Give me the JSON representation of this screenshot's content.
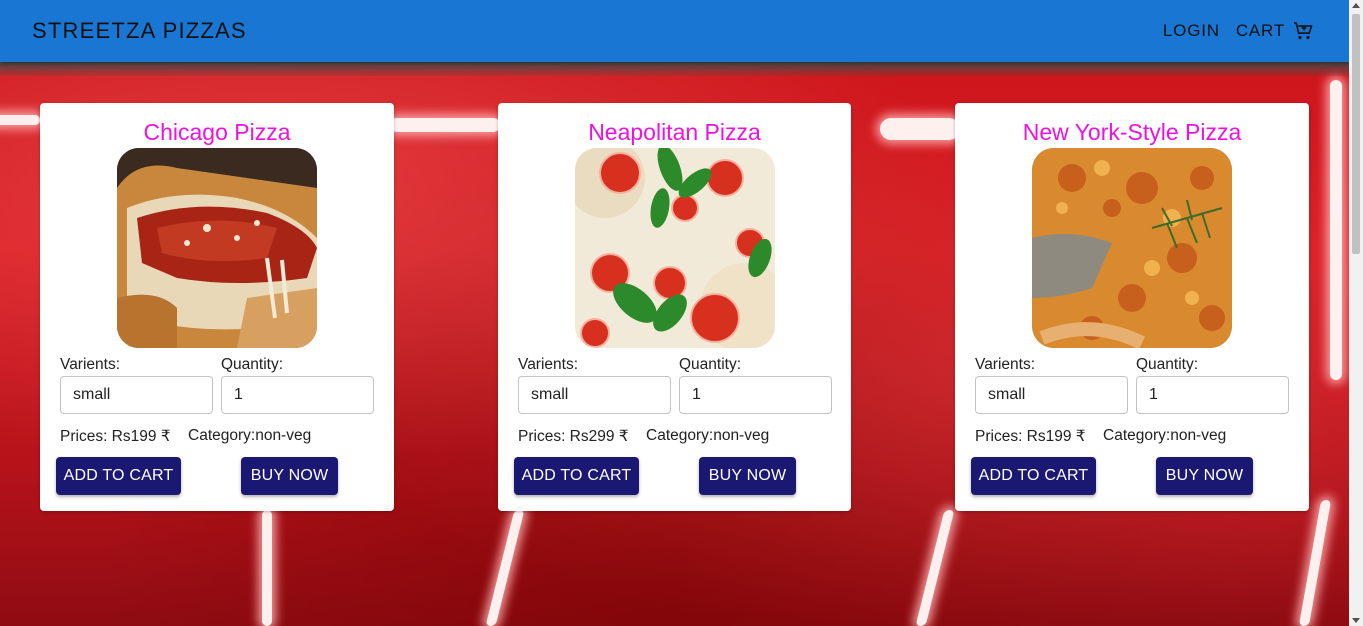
{
  "header": {
    "brand": "STREETZA PIZZAS",
    "login_label": "LOGIN",
    "cart_label": "CART",
    "cart_icon": "cart-icon",
    "bar_color": "#1976d2"
  },
  "colors": {
    "title": "#ee12e0",
    "button": "#1a1872",
    "background": "#d81c22"
  },
  "cards": [
    {
      "title": "Chicago Pizza",
      "variants_label": "Varients:",
      "quantity_label": "Quantity:",
      "variant_value": "small",
      "quantity_value": "1",
      "price_text": "Prices: Rs199 ₹",
      "category_text": "Category:non-veg",
      "add_label": "ADD TO CART",
      "buy_label": "BUY NOW"
    },
    {
      "title": "Neapolitan Pizza",
      "variants_label": "Varients:",
      "quantity_label": "Quantity:",
      "variant_value": "small",
      "quantity_value": "1",
      "price_text": "Prices: Rs299 ₹",
      "category_text": "Category:non-veg",
      "add_label": "ADD TO CART",
      "buy_label": "BUY NOW"
    },
    {
      "title": "New York-Style Pizza",
      "variants_label": "Varients:",
      "quantity_label": "Quantity:",
      "variant_value": "small",
      "quantity_value": "1",
      "price_text": "Prices: Rs199 ₹",
      "category_text": "Category:non-veg",
      "add_label": "ADD TO CART",
      "buy_label": "BUY NOW"
    }
  ]
}
